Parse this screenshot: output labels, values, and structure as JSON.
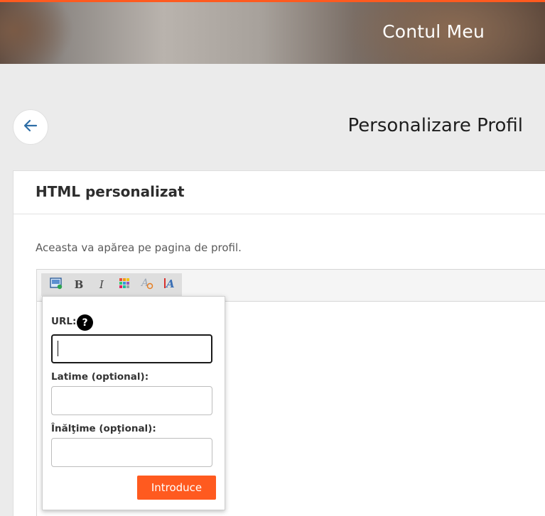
{
  "header": {
    "title": "Contul Meu",
    "accent_color": "#ff5a1f"
  },
  "page": {
    "title": "Personalizare Profil",
    "back_icon": "arrow-left-icon"
  },
  "card": {
    "title": "HTML personalizat",
    "description": "Aceasta va apărea pe pagina de profil."
  },
  "toolbar": {
    "buttons": [
      {
        "name": "insert-image",
        "icon": "image-icon",
        "label": ""
      },
      {
        "name": "bold",
        "icon": "bold-icon",
        "label": "B"
      },
      {
        "name": "italic",
        "icon": "italic-icon",
        "label": "I"
      },
      {
        "name": "color",
        "icon": "color-grid-icon",
        "label": ""
      },
      {
        "name": "remove-format",
        "icon": "remove-format-icon",
        "label": ""
      },
      {
        "name": "source",
        "icon": "source-icon",
        "label": ""
      }
    ]
  },
  "image_popup": {
    "url_label": "URL:",
    "help_label": "?",
    "url_value": "",
    "width_label": "Latime (optional):",
    "width_value": "",
    "height_label": "Înălţime (opţional):",
    "height_value": "",
    "submit_label": "Introduce"
  }
}
